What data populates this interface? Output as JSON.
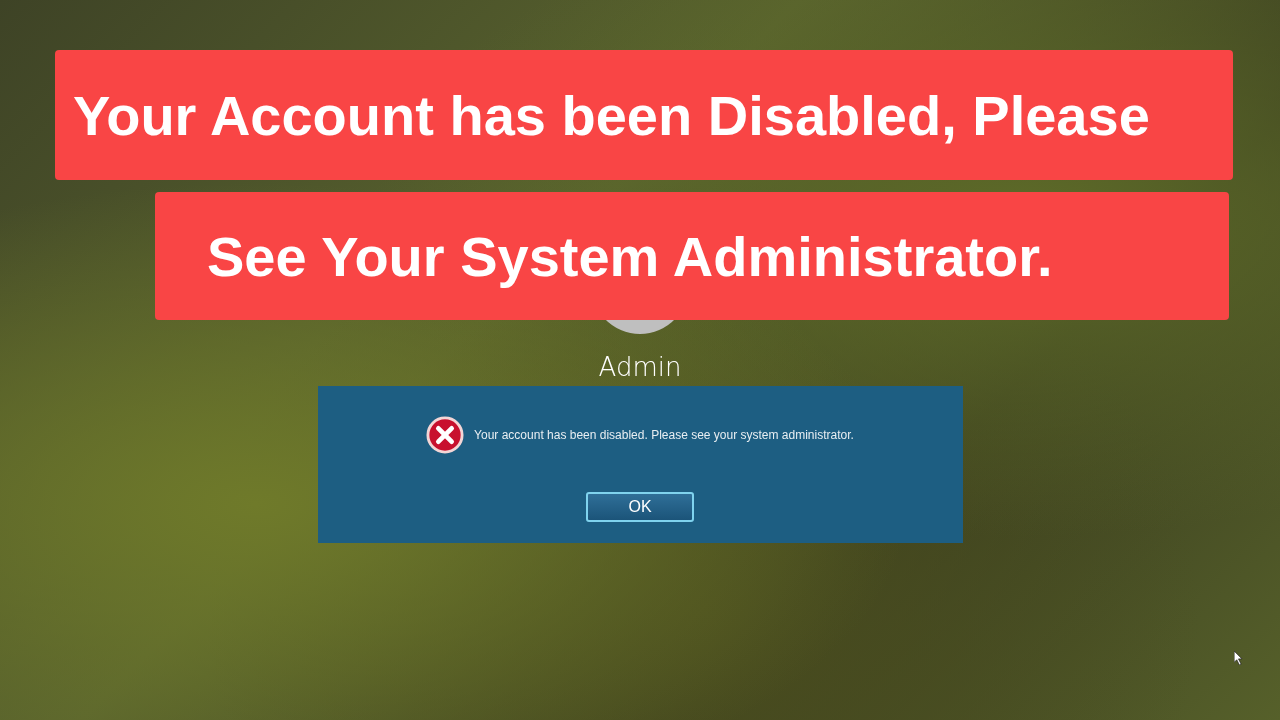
{
  "banners": [
    "Your Account has been Disabled, Please",
    "See Your System Administrator."
  ],
  "login": {
    "username": "Admin"
  },
  "dialog": {
    "message": "Your account has been disabled.  Please see your system administrator.",
    "buttons": [
      "OK"
    ]
  }
}
